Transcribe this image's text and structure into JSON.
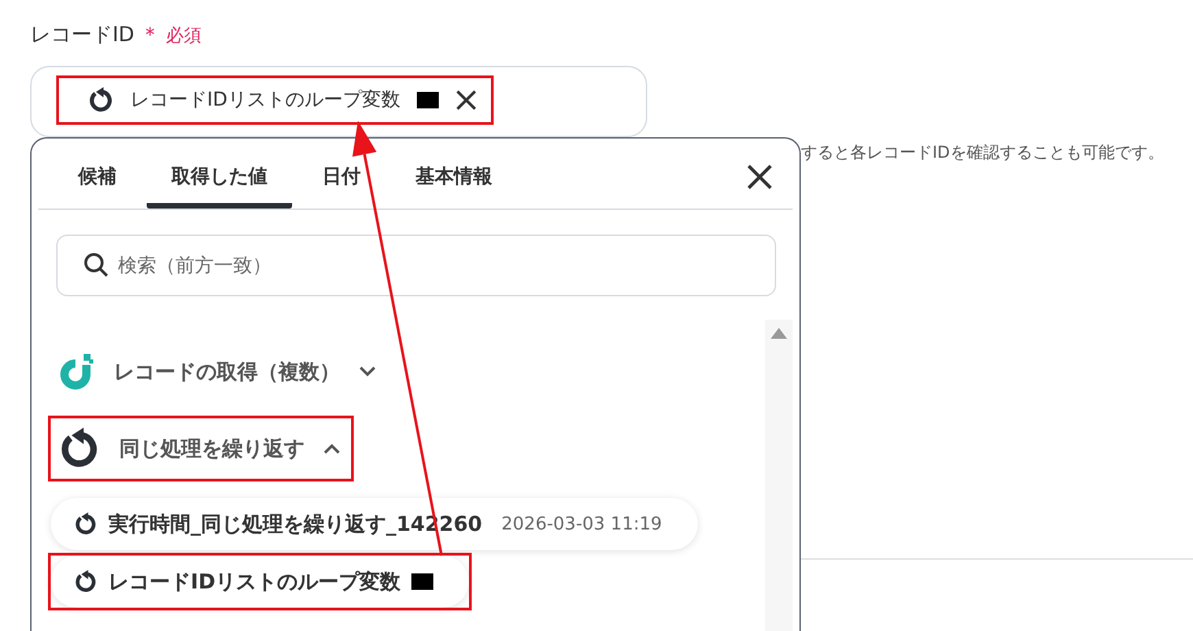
{
  "field": {
    "label": "レコードID",
    "required_mark": "＊",
    "required_text": "必須",
    "chip": {
      "label": "レコードIDリストのループ変数",
      "highlighted": true
    }
  },
  "help_text": "すると各レコードIDを確認することも可能です。",
  "picker": {
    "tabs": [
      {
        "label": "候補",
        "selected": false
      },
      {
        "label": "取得した値",
        "selected": true
      },
      {
        "label": "日付",
        "selected": false
      },
      {
        "label": "基本情報",
        "selected": false
      }
    ],
    "search": {
      "placeholder": "検索（前方一致）"
    },
    "groups": [
      {
        "kind": "app",
        "title": "レコードの取得（複数）",
        "expanded": false,
        "highlighted": false
      },
      {
        "kind": "loop",
        "title": "同じ処理を繰り返す",
        "expanded": true,
        "highlighted": true,
        "children": [
          {
            "label": "実行時間_同じ処理を繰り返す_142260",
            "time": "2026-03-03 11:19",
            "highlighted": false
          },
          {
            "label": "レコードIDリストのループ変数",
            "highlighted": true
          }
        ]
      }
    ]
  }
}
